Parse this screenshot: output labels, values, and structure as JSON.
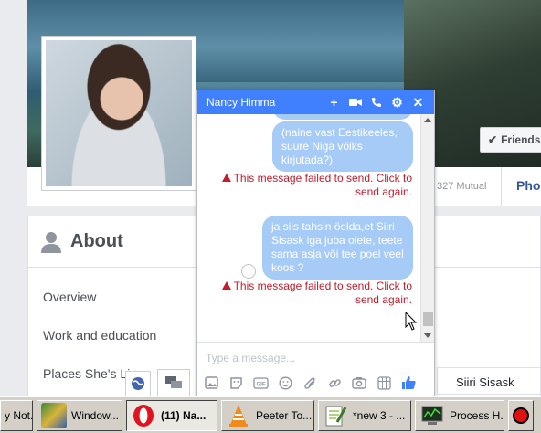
{
  "profile": {
    "friends_button": "Friends",
    "mutual": "327 Mutual",
    "photos_tab": "Pho"
  },
  "about": {
    "title": "About",
    "items": [
      "Overview",
      "Work and education",
      "Places She's Li"
    ]
  },
  "chat": {
    "title": "Nancy Himma",
    "messages": [
      {
        "text": "(naine vast Eestikeeles, suure Niga võiks kirjutada?)"
      },
      {
        "text": "ja siis tahsin öelda,et Siiri Sisask iga juba olete, teete sama asja või tee poel veel koos ?"
      }
    ],
    "error_text_1": "This message failed to send. Click to send again.",
    "error_text_2": "This message failed to send. Click to send again.",
    "input_placeholder": "Type a message...",
    "tools": [
      "photo-icon",
      "sticker-icon",
      "gif-icon",
      "emoji-icon",
      "attachment-icon",
      "link-icon",
      "camera-icon",
      "game-icon",
      "like-icon"
    ]
  },
  "sidebar_contact": "Siiri Sisask",
  "taskbar": {
    "tasks": [
      {
        "label": "y Not..."
      },
      {
        "label": "Window..."
      },
      {
        "label": "(11) Na..."
      },
      {
        "label": "Peeter To..."
      },
      {
        "label": "*new 3 - ..."
      },
      {
        "label": "Process H..."
      }
    ]
  }
}
